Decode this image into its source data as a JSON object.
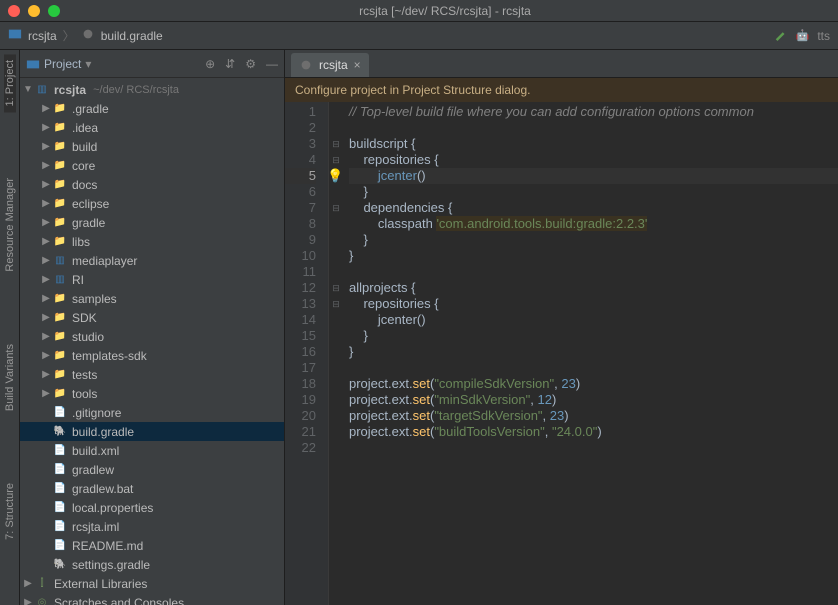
{
  "title": "rcsjta [~/dev/          RCS/rcsjta] - rcsjta",
  "breadcrumb": {
    "project": "rcsjta",
    "file": "build.gradle",
    "tts_label": "tts"
  },
  "sidebar_header": {
    "label": "Project"
  },
  "leftrail": [
    "1: Project",
    "Resource Manager",
    "Build Variants",
    "7: Structure"
  ],
  "tree": {
    "root": {
      "name": "rcsjta",
      "path": "~/dev/          RCS/rcsjta"
    },
    "children": [
      {
        "name": ".gradle",
        "type": "folder-ex"
      },
      {
        "name": ".idea",
        "type": "folder-ex"
      },
      {
        "name": "build",
        "type": "folder-ex"
      },
      {
        "name": "core",
        "type": "folder"
      },
      {
        "name": "docs",
        "type": "folder"
      },
      {
        "name": "eclipse",
        "type": "folder"
      },
      {
        "name": "gradle",
        "type": "folder"
      },
      {
        "name": "libs",
        "type": "folder"
      },
      {
        "name": "mediaplayer",
        "type": "module"
      },
      {
        "name": "RI",
        "type": "module"
      },
      {
        "name": "samples",
        "type": "folder"
      },
      {
        "name": "SDK",
        "type": "folder"
      },
      {
        "name": "studio",
        "type": "folder"
      },
      {
        "name": "templates-sdk",
        "type": "folder"
      },
      {
        "name": "tests",
        "type": "folder"
      },
      {
        "name": "tools",
        "type": "folder"
      },
      {
        "name": ".gitignore",
        "type": "file"
      },
      {
        "name": "build.gradle",
        "type": "gradle",
        "selected": true
      },
      {
        "name": "build.xml",
        "type": "file"
      },
      {
        "name": "gradlew",
        "type": "file"
      },
      {
        "name": "gradlew.bat",
        "type": "file"
      },
      {
        "name": "local.properties",
        "type": "file"
      },
      {
        "name": "rcsjta.iml",
        "type": "file"
      },
      {
        "name": "README.md",
        "type": "file"
      },
      {
        "name": "settings.gradle",
        "type": "gradle"
      }
    ],
    "footer": [
      "External Libraries",
      "Scratches and Consoles"
    ]
  },
  "tab": {
    "label": "rcsjta"
  },
  "banner": "Configure project in Project Structure dialog.",
  "code_lines": 22,
  "highlight_line": 5,
  "code": {
    "1": {
      "t": "com",
      "v": "// Top-level build file where you can add configuration options common"
    },
    "2": {
      "t": "",
      "v": ""
    },
    "3": {
      "html": "<span class='c-id'>buildscript </span>{"
    },
    "4": {
      "html": "    <span class='c-id'>repositories </span>{"
    },
    "5": {
      "html": "        <span class='c-link'>jcenter</span>()"
    },
    "6": {
      "html": "    }"
    },
    "7": {
      "html": "    <span class='c-id'>dependencies </span>{"
    },
    "8": {
      "html": "        <span class='c-id'>classpath </span><span class='c-strhl'>'com.android.tools.build:gradle:2.2.3'</span>"
    },
    "9": {
      "html": "    }"
    },
    "10": {
      "html": "}"
    },
    "11": {
      "html": ""
    },
    "12": {
      "html": "<span class='c-id'>allprojects </span>{"
    },
    "13": {
      "html": "    <span class='c-id'>repositories </span>{"
    },
    "14": {
      "html": "        jcenter()"
    },
    "15": {
      "html": "    }"
    },
    "16": {
      "html": "}"
    },
    "17": {
      "html": ""
    },
    "18": {
      "html": "<span class='c-id'>project</span>.<span class='c-id'>ext</span>.<span class='c-fn'>set</span>(<span class='c-str'>\"compileSdkVersion\"</span>, <span class='c-num'>23</span>)"
    },
    "19": {
      "html": "<span class='c-id'>project</span>.<span class='c-id'>ext</span>.<span class='c-fn'>set</span>(<span class='c-str'>\"minSdkVersion\"</span>, <span class='c-num'>12</span>)"
    },
    "20": {
      "html": "<span class='c-id'>project</span>.<span class='c-id'>ext</span>.<span class='c-fn'>set</span>(<span class='c-str'>\"targetSdkVersion\"</span>, <span class='c-num'>23</span>)"
    },
    "21": {
      "html": "<span class='c-id'>project</span>.<span class='c-id'>ext</span>.<span class='c-fn'>set</span>(<span class='c-str'>\"buildToolsVersion\"</span>, <span class='c-str'>\"24.0.0\"</span>)"
    },
    "22": {
      "html": ""
    }
  }
}
